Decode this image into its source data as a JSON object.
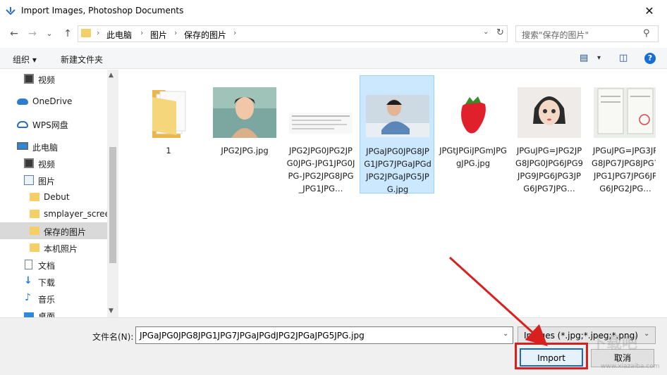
{
  "window": {
    "title": "Import Images, Photoshop Documents",
    "close_glyph": "✕"
  },
  "nav": {
    "back_glyph": "←",
    "forward_glyph": "→",
    "history_glyph": "⌄",
    "up_glyph": "↑",
    "breadcrumbs": [
      "此电脑",
      "图片",
      "保存的图片"
    ],
    "separator": "›",
    "dropdown_glyph": "⌄",
    "refresh_glyph": "↻",
    "search_placeholder": "搜索\"保存的图片\"",
    "search_glyph": "⚲"
  },
  "toolbar": {
    "organize": "组织 ▾",
    "new_folder": "新建文件夹",
    "view_glyph": "▤",
    "view_dd_glyph": "▾",
    "pane_glyph": "◫",
    "help_glyph": "?"
  },
  "sidebar": {
    "items": [
      {
        "label": "视频",
        "icon": "video-icon"
      },
      {
        "label": "OneDrive",
        "icon": "cloud-icon"
      },
      {
        "label": "WPS网盘",
        "icon": "wps-cloud-icon"
      },
      {
        "label": "此电脑",
        "icon": "computer-icon"
      },
      {
        "label": "视频",
        "icon": "video-icon"
      },
      {
        "label": "图片",
        "icon": "pictures-icon"
      },
      {
        "label": "Debut",
        "icon": "folder-icon"
      },
      {
        "label": "smplayer_scree",
        "icon": "folder-icon"
      },
      {
        "label": "保存的图片",
        "icon": "folder-icon"
      },
      {
        "label": "本机照片",
        "icon": "folder-icon"
      },
      {
        "label": "文档",
        "icon": "document-icon"
      },
      {
        "label": "下载",
        "icon": "download-icon"
      },
      {
        "label": "音乐",
        "icon": "music-icon"
      },
      {
        "label": "桌面",
        "icon": "desktop-icon"
      }
    ],
    "selected_label": "保存的图片",
    "scroll_up_glyph": "▲",
    "scroll_down_glyph": "▼"
  },
  "files": [
    {
      "name": "1",
      "kind": "folder"
    },
    {
      "name": "JPG2JPG.jpg",
      "kind": "anime-portrait"
    },
    {
      "name": "JPG2JPG0JPG2JPG0JPG-JPG1JPG0JPG-JPG2JPG8JPG_JPG1JPG…",
      "kind": "document-scan"
    },
    {
      "name": "JPGaJPG0JPG8JPG1JPG7JPGaJPGdJPG2JPGaJPG5JPG.jpg",
      "kind": "boy-photo"
    },
    {
      "name": "JPGtJPGiJPGmJPGgJPG.jpg",
      "kind": "strawberry"
    },
    {
      "name": "JPGuJPG=JPG2JPG8JPG0JPG6JPG9JPG9JPG6JPG3JPG6JPG7JPG…",
      "kind": "cartoon-girl"
    },
    {
      "name": "JPGuJPG=JPG3JPG8JPG7JPG8JPG7JPG1JPG7JPG6JPG6JPG2JPG…",
      "kind": "certificate"
    }
  ],
  "footer": {
    "filename_label": "文件名(N):",
    "filename_value": "JPGaJPG0JPG8JPG1JPG7JPGaJPGdJPG2JPGaJPG5JPG.jpg",
    "filetype_value": "Images (*.jpg;*.jpeg;*.png)",
    "dropdown_glyph": "⌄",
    "import_label": "Import",
    "cancel_label": "取消",
    "watermark_big": "下载吧",
    "watermark_small": "www.xiazaiba.com"
  },
  "colors": {
    "accent": "#1a6fd4",
    "selection": "#cce8ff",
    "annotation": "#d8201f"
  }
}
